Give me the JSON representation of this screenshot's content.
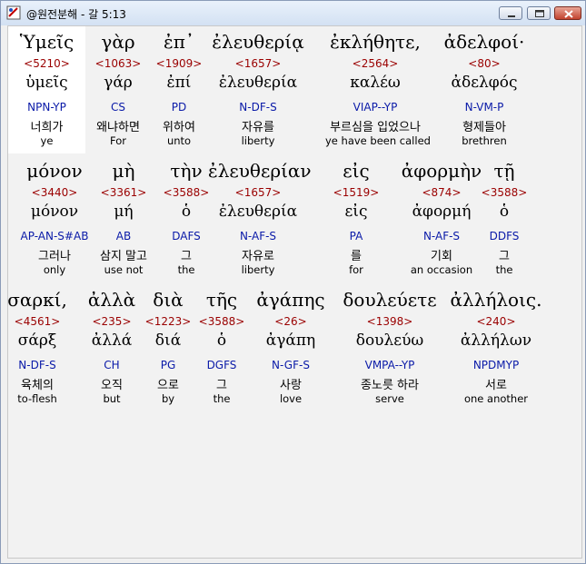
{
  "window": {
    "title": "@원전분해 - 갈 5:13",
    "icon": "app-icon",
    "buttons": [
      "minimize-icon",
      "maximize-icon",
      "close-icon"
    ]
  },
  "colors": {
    "strongs": "#9a0000",
    "parsing": "#0a1aa8",
    "text": "#000000",
    "selected_bg": "#ffffff"
  },
  "rows": [
    {
      "words": [
        {
          "greek": "Ὑμεῖς",
          "strongs": "<5210>",
          "lemma": "ὑμεῖς",
          "parsing": "NPN-YP",
          "korean": "너희가",
          "english": "ye",
          "selected": true
        },
        {
          "greek": "γὰρ",
          "strongs": "<1063>",
          "lemma": "γάρ",
          "parsing": "CS",
          "korean": "왜냐하면",
          "english": "For"
        },
        {
          "greek": "ἐπ᾽",
          "strongs": "<1909>",
          "lemma": "ἐπί",
          "parsing": "PD",
          "korean": "위하여",
          "english": "unto"
        },
        {
          "greek": "ἐλευθερίᾳ",
          "strongs": "<1657>",
          "lemma": "ἐλευθερία",
          "parsing": "N-DF-S",
          "korean": "자유를",
          "english": "liberty"
        },
        {
          "greek": "ἐκλήθητε,",
          "strongs": "<2564>",
          "lemma": "καλέω",
          "parsing": "VIAP--YP",
          "korean": "부르심을 입었으나",
          "english": "ye have been called"
        },
        {
          "greek": "ἀδελφοί·",
          "strongs": "<80>",
          "lemma": "ἀδελφός",
          "parsing": "N-VM-P",
          "korean": "형제들아",
          "english": "brethren"
        }
      ]
    },
    {
      "words": [
        {
          "greek": "μόνον",
          "strongs": "<3440>",
          "lemma": "μόνον",
          "parsing": "AP-AN-S#AB",
          "korean": "그러나",
          "english": "only"
        },
        {
          "greek": "μὴ",
          "strongs": "<3361>",
          "lemma": "μή",
          "parsing": "AB",
          "korean": "삼지 말고",
          "english": "use not"
        },
        {
          "greek": "τὴν",
          "strongs": "<3588>",
          "lemma": "ὁ",
          "parsing": "DAFS",
          "korean": "그",
          "english": "the"
        },
        {
          "greek": "ἐλευθερίαν",
          "strongs": "<1657>",
          "lemma": "ἐλευθερία",
          "parsing": "N-AF-S",
          "korean": "자유로",
          "english": "liberty"
        },
        {
          "greek": "εἰς",
          "strongs": "<1519>",
          "lemma": "εἰς",
          "parsing": "PA",
          "korean": "를",
          "english": "for"
        },
        {
          "greek": "ἀφορμὴν",
          "strongs": "<874>",
          "lemma": "ἀφορμή",
          "parsing": "N-AF-S",
          "korean": "기회",
          "english": "an occasion"
        },
        {
          "greek": "τῇ",
          "strongs": "<3588>",
          "lemma": "ὁ",
          "parsing": "DDFS",
          "korean": "그",
          "english": "the"
        }
      ]
    },
    {
      "words": [
        {
          "greek": "σαρκί,",
          "strongs": "<4561>",
          "lemma": "σάρξ",
          "parsing": "N-DF-S",
          "korean": "육체의",
          "english": "to-flesh"
        },
        {
          "greek": "ἀλλὰ",
          "strongs": "<235>",
          "lemma": "ἀλλά",
          "parsing": "CH",
          "korean": "오직",
          "english": "but"
        },
        {
          "greek": "διὰ",
          "strongs": "<1223>",
          "lemma": "διά",
          "parsing": "PG",
          "korean": "으로",
          "english": "by"
        },
        {
          "greek": "τῆς",
          "strongs": "<3588>",
          "lemma": "ὁ",
          "parsing": "DGFS",
          "korean": "그",
          "english": "the"
        },
        {
          "greek": "ἀγάπης",
          "strongs": "<26>",
          "lemma": "ἀγάπη",
          "parsing": "N-GF-S",
          "korean": "사랑",
          "english": "love"
        },
        {
          "greek": "δουλεύετε",
          "strongs": "<1398>",
          "lemma": "δουλεύω",
          "parsing": "VMPA--YP",
          "korean": "종노릇 하라",
          "english": "serve"
        },
        {
          "greek": "ἀλλήλοις.",
          "strongs": "<240>",
          "lemma": "ἀλλήλων",
          "parsing": "NPDMYP",
          "korean": "서로",
          "english": "one another"
        }
      ]
    }
  ]
}
